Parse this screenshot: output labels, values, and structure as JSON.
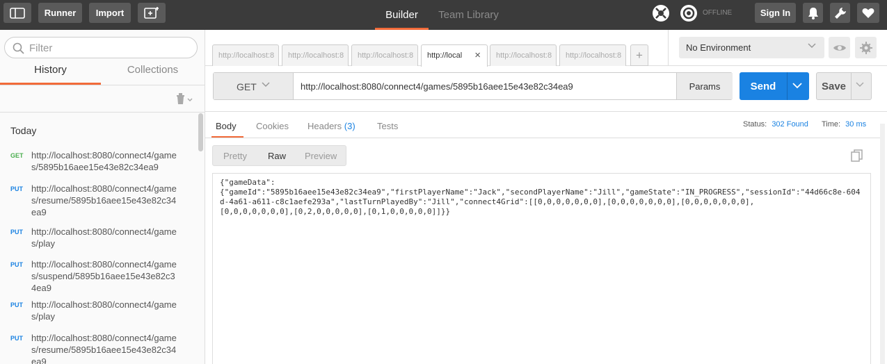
{
  "topbar": {
    "runner_label": "Runner",
    "import_label": "Import",
    "tabs": [
      {
        "label": "Builder",
        "active": true
      },
      {
        "label": "Team Library",
        "active": false
      }
    ],
    "sync_status": "OFFLINE",
    "signin_label": "Sign In"
  },
  "sidebar": {
    "filter_placeholder": "Filter",
    "tabs": [
      {
        "label": "History",
        "active": true
      },
      {
        "label": "Collections",
        "active": false
      }
    ],
    "section_title": "Today",
    "history": [
      {
        "method": "GET",
        "url": "http://localhost:8080/connect4/games/5895b16aee15e43e82c34ea9"
      },
      {
        "method": "PUT",
        "url": "http://localhost:8080/connect4/games/resume/5895b16aee15e43e82c34ea9"
      },
      {
        "method": "PUT",
        "url": "http://localhost:8080/connect4/games/play"
      },
      {
        "method": "PUT",
        "url": "http://localhost:8080/connect4/games/suspend/5895b16aee15e43e82c34ea9"
      },
      {
        "method": "PUT",
        "url": "http://localhost:8080/connect4/games/play"
      },
      {
        "method": "PUT",
        "url": "http://localhost:8080/connect4/games/resume/5895b16aee15e43e82c34ea9"
      }
    ],
    "method_colors": {
      "GET": "#4caf50",
      "PUT": "#1a82e2"
    }
  },
  "request_tabs": [
    {
      "label": "http://localhost:8",
      "active": false
    },
    {
      "label": "http://localhost:8",
      "active": false
    },
    {
      "label": "http://localhost:8",
      "active": false
    },
    {
      "label": "http://local",
      "active": true
    },
    {
      "label": "http://localhost:8",
      "active": false
    },
    {
      "label": "http://localhost:8",
      "active": false
    }
  ],
  "environment": {
    "selected": "No Environment"
  },
  "request": {
    "method": "GET",
    "url": "http://localhost:8080/connect4/games/5895b16aee15e43e82c34ea9",
    "params_label": "Params",
    "send_label": "Send",
    "save_label": "Save"
  },
  "response": {
    "tabs": [
      {
        "label": "Body",
        "active": true
      },
      {
        "label": "Cookies",
        "active": false
      },
      {
        "label": "Headers",
        "active": false
      },
      {
        "label": "Tests",
        "active": false
      }
    ],
    "headers_count": "(3)",
    "status_label": "Status:",
    "status_value": "302 Found",
    "time_label": "Time:",
    "time_value": "30 ms",
    "view_modes": [
      {
        "label": "Pretty",
        "active": false
      },
      {
        "label": "Raw",
        "active": true
      },
      {
        "label": "Preview",
        "active": false
      }
    ],
    "body": "{\"gameData\":\n{\"gameId\":\"5895b16aee15e43e82c34ea9\",\"firstPlayerName\":\"Jack\",\"secondPlayerName\":\"Jill\",\"gameState\":\"IN_PROGRESS\",\"sessionId\":\"44d66c8e-604d-4a61-a611-c8c1aefe293a\",\"lastTurnPlayedBy\":\"Jill\",\"connect4Grid\":[[0,0,0,0,0,0,0],[0,0,0,0,0,0,0],[0,0,0,0,0,0,0],\n[0,0,0,0,0,0,0],[0,2,0,0,0,0,0],[0,1,0,0,0,0,0]]}}"
  },
  "colors": {
    "accent": "#f26b3a",
    "primary": "#1a82e2",
    "topbar": "#3b3b3b"
  }
}
